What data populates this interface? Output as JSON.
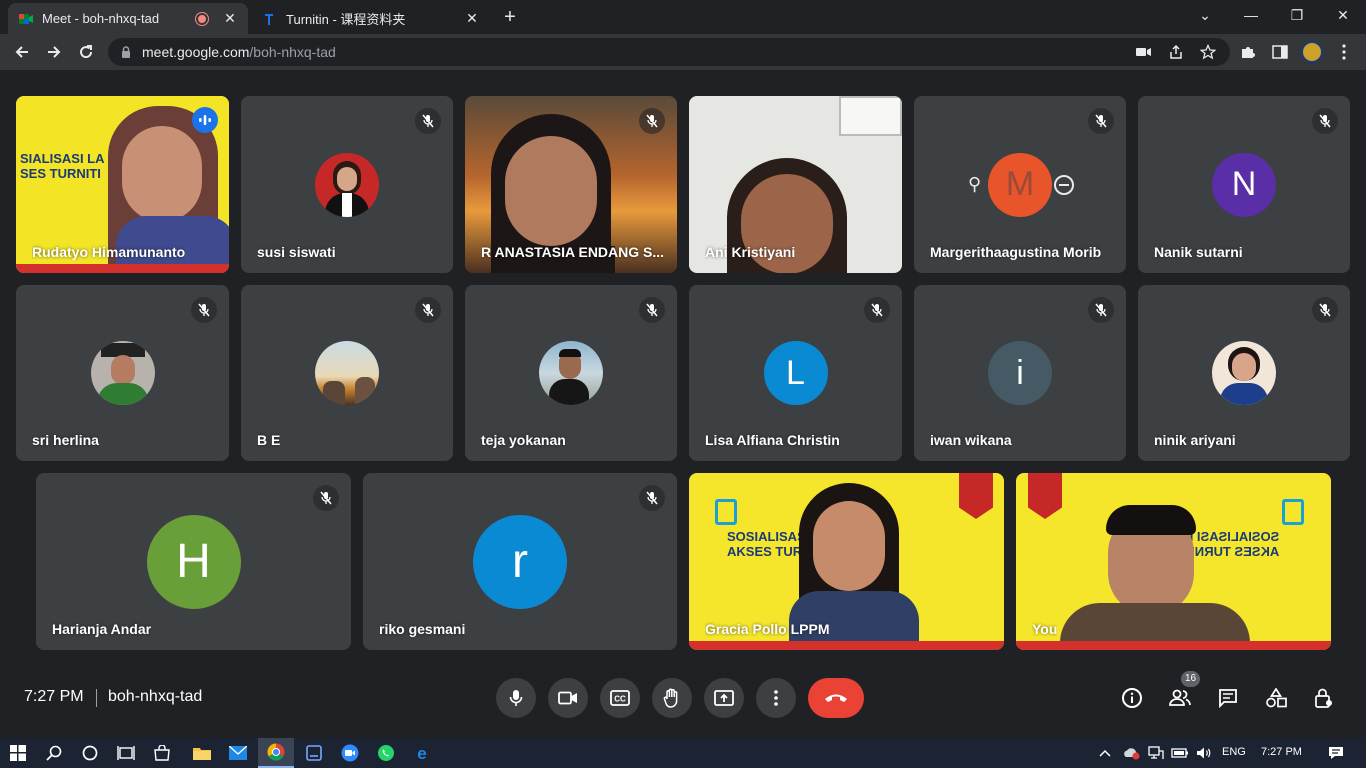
{
  "browser": {
    "tabs": [
      {
        "title": "Meet - boh-nhxq-tad",
        "active": true
      },
      {
        "title": "Turnitin - 课程资料夹",
        "active": false
      }
    ],
    "url_host": "meet.google.com",
    "url_path": "/boh-nhxq-tad"
  },
  "participants": [
    {
      "name": "Rudatyo Himamunanto",
      "type": "video",
      "speaking": true
    },
    {
      "name": "susi siswati",
      "type": "photo",
      "muted": true
    },
    {
      "name": "R ANASTASIA ENDANG S...",
      "type": "video",
      "muted": true
    },
    {
      "name": "Ani Kristiyani",
      "type": "video"
    },
    {
      "name": "Margerithaagustina Morib",
      "type": "initial",
      "initial": "M",
      "color": "#e8552a",
      "muted": true
    },
    {
      "name": "Nanik sutarni",
      "type": "initial",
      "initial": "N",
      "color": "#5a2ea6",
      "muted": true
    },
    {
      "name": "sri herlina",
      "type": "photo",
      "muted": true
    },
    {
      "name": "B E",
      "type": "photo",
      "muted": true
    },
    {
      "name": "teja yokanan",
      "type": "photo",
      "muted": true
    },
    {
      "name": "Lisa Alfiana Christin",
      "type": "initial",
      "initial": "L",
      "color": "#0b8ad4",
      "muted": true
    },
    {
      "name": "iwan wikana",
      "type": "initial",
      "initial": "i",
      "color": "#455a64",
      "muted": true
    },
    {
      "name": "ninik ariyani",
      "type": "photo",
      "muted": true
    },
    {
      "name": "Harianja Andar",
      "type": "initial",
      "initial": "H",
      "color": "#689f38",
      "muted": true
    },
    {
      "name": "riko gesmani",
      "type": "initial",
      "initial": "r",
      "color": "#0b8ad4",
      "muted": true
    },
    {
      "name": "Gracia Pollo LPPM",
      "type": "video"
    },
    {
      "name": "You",
      "type": "video"
    }
  ],
  "banners": {
    "rudatyo": [
      "SIALISASI LA",
      "SES TURNITI"
    ],
    "gracia": [
      "SOSIALISAS",
      "AKSES TUR"
    ],
    "you": [
      "SOSIALISASI LA",
      "AKSES TURNITI"
    ]
  },
  "meeting": {
    "time": "7:27 PM",
    "code": "boh-nhxq-tad",
    "participant_count": "16"
  },
  "taskbar": {
    "lang": "ENG",
    "time": "7:27 PM"
  },
  "colors": {
    "accent": "#8ab4f8",
    "end_call": "#ea4335",
    "tile_bg": "#3c4043",
    "page_bg": "#202124"
  }
}
